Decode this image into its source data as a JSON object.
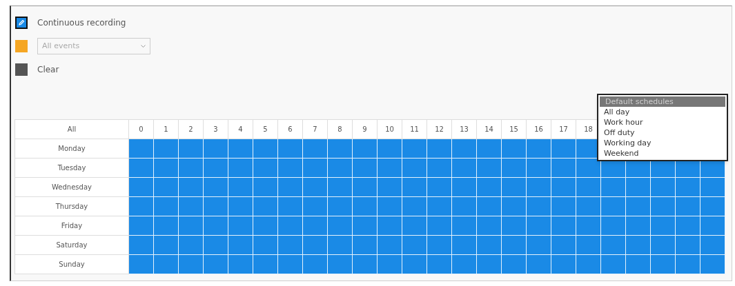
{
  "legend": [
    {
      "kind": "swatch",
      "label": "Continuous recording",
      "color": "#1a8ae6",
      "selected": true
    },
    {
      "kind": "dropdown",
      "value": "All events",
      "disabled": true,
      "color": "#f5a623",
      "selected": false
    },
    {
      "kind": "swatch",
      "label": "Clear",
      "color": "#555555",
      "selected": false
    }
  ],
  "schedule": {
    "corner": "All",
    "hours": [
      "0",
      "1",
      "2",
      "3",
      "4",
      "5",
      "6",
      "7",
      "8",
      "9",
      "10",
      "11",
      "12",
      "13",
      "14",
      "15",
      "16",
      "17",
      "18"
    ],
    "days": [
      {
        "label": "Monday",
        "recorded": true
      },
      {
        "label": "Tuesday",
        "recorded": true
      },
      {
        "label": "Wednesday",
        "recorded": true
      },
      {
        "label": "Thursday",
        "recorded": true
      },
      {
        "label": "Friday",
        "recorded": true
      },
      {
        "label": "Saturday",
        "recorded": true
      },
      {
        "label": "Sunday",
        "recorded": true
      }
    ]
  },
  "schedule_menu": {
    "title": "Default schedules",
    "options": [
      "All day",
      "Work hour",
      "Off duty",
      "Working day",
      "Weekend"
    ]
  }
}
